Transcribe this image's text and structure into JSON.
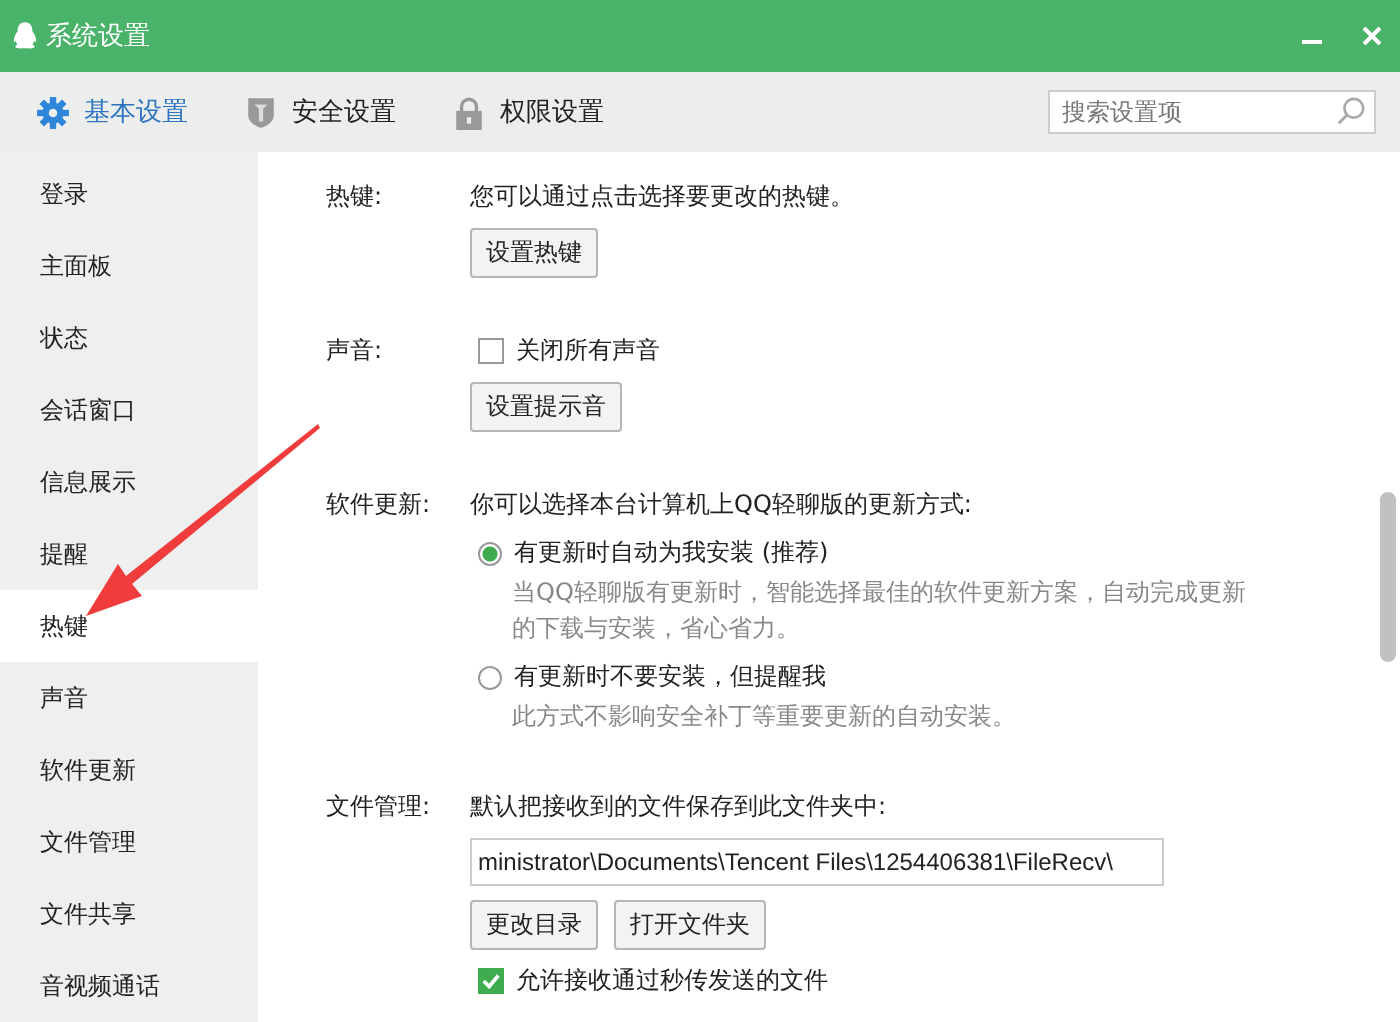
{
  "window": {
    "title": "系统设置"
  },
  "tabs": [
    {
      "label": "基本设置",
      "selected": true,
      "kind": "gear"
    },
    {
      "label": "安全设置",
      "selected": false,
      "kind": "shield"
    },
    {
      "label": "权限设置",
      "selected": false,
      "kind": "lock"
    }
  ],
  "search": {
    "placeholder": "搜索设置项"
  },
  "sidebar": {
    "items": [
      {
        "label": "登录",
        "selected": false
      },
      {
        "label": "主面板",
        "selected": false
      },
      {
        "label": "状态",
        "selected": false
      },
      {
        "label": "会话窗口",
        "selected": false
      },
      {
        "label": "信息展示",
        "selected": false
      },
      {
        "label": "提醒",
        "selected": false
      },
      {
        "label": "热键",
        "selected": true
      },
      {
        "label": "声音",
        "selected": false
      },
      {
        "label": "软件更新",
        "selected": false
      },
      {
        "label": "文件管理",
        "selected": false
      },
      {
        "label": "文件共享",
        "selected": false
      },
      {
        "label": "音视频通话",
        "selected": false
      }
    ]
  },
  "hotkeys": {
    "label": "热键:",
    "text": "您可以通过点击选择要更改的热键。",
    "button": "设置热键"
  },
  "sound": {
    "label": "声音:",
    "checkbox": {
      "label": "关闭所有声音",
      "checked": false
    },
    "button": "设置提示音"
  },
  "update": {
    "label": "软件更新:",
    "text": "你可以选择本台计算机上QQ轻聊版的更新方式:",
    "options": [
      {
        "label": "有更新时自动为我安装 (推荐)",
        "selected": true,
        "description": "当QQ轻聊版有更新时，智能选择最佳的软件更新方案，自动完成更新的下载与安装，省心省力。"
      },
      {
        "label": "有更新时不要安装，但提醒我",
        "selected": false,
        "description": "此方式不影响安全补丁等重要更新的自动安装。"
      }
    ]
  },
  "files": {
    "label": "文件管理:",
    "text": "默认把接收到的文件保存到此文件夹中:",
    "path": "ministrator\\Documents\\Tencent Files\\1254406381\\FileRecv\\",
    "buttons": [
      "更改目录",
      "打开文件夹"
    ],
    "checkbox": {
      "label": "允许接收通过秒传发送的文件",
      "checked": true
    }
  }
}
